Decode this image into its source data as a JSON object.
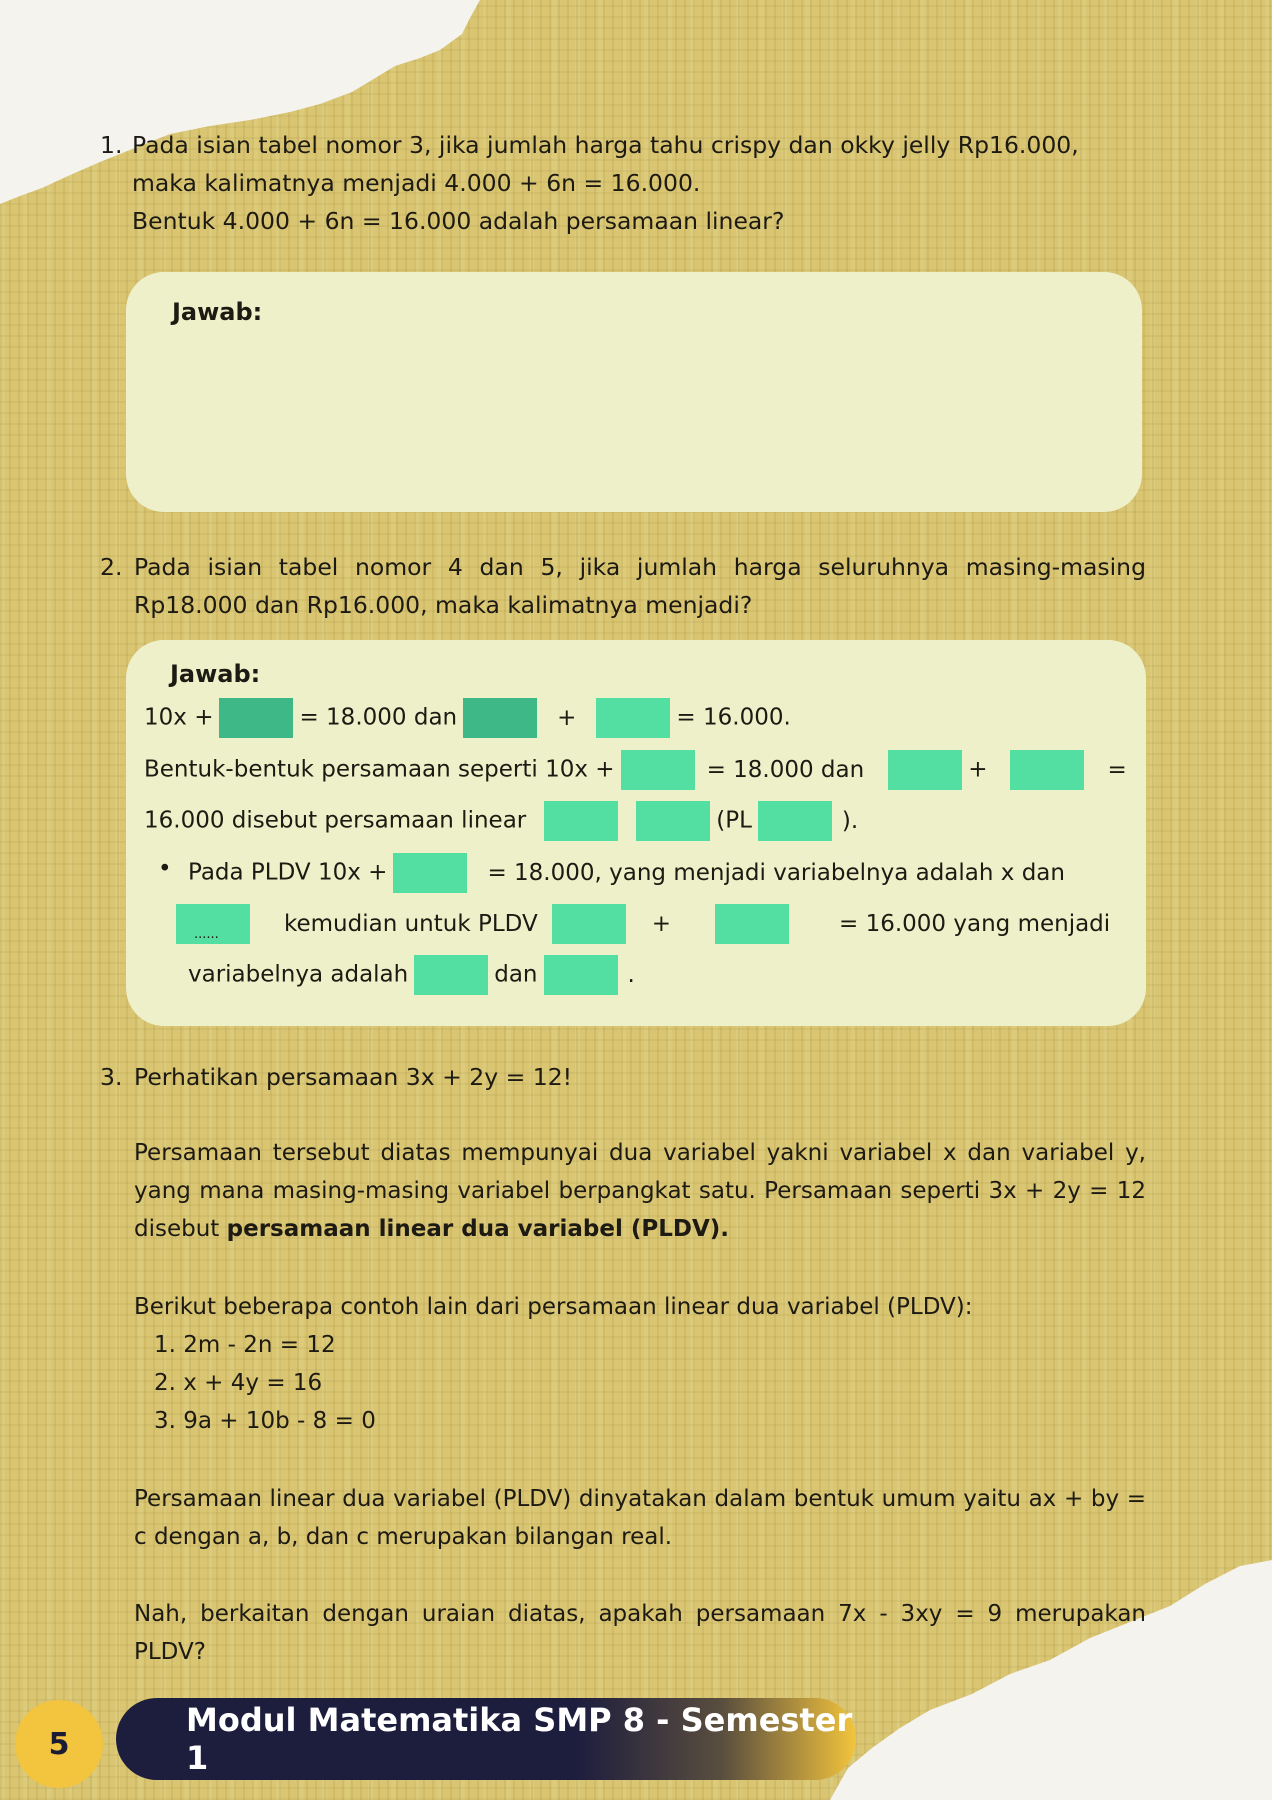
{
  "q1": {
    "number": "1.",
    "line1": "Pada isian tabel nomor 3, jika jumlah harga tahu crispy dan okky jelly Rp16.000,",
    "line2": "maka kalimatnya menjadi 4.000 + 6n = 16.000.",
    "line3": "Bentuk 4.000 + 6n = 16.000 adalah persamaan linear?",
    "answer_label": "Jawab:"
  },
  "q2": {
    "number": "2.",
    "text": "Pada isian tabel nomor 4 dan 5, jika jumlah harga seluruhnya masing-masing Rp18.000 dan Rp16.000, maka kalimatnya menjadi?",
    "answer_label": "Jawab:",
    "row1": {
      "a": "10x +",
      "b": "= 18.000 dan",
      "c": "+",
      "d": "= 16.000."
    },
    "row2": {
      "a": "Bentuk-bentuk persamaan seperti 10x +",
      "b": "= 18.000 dan",
      "c": "+",
      "d": "="
    },
    "row3": {
      "a": "16.000 disebut persamaan linear",
      "b": "(PL",
      "c": ")."
    },
    "bullet_row1": {
      "a": "Pada PLDV 10x +",
      "b": "= 18.000, yang menjadi variabelnya adalah x dan"
    },
    "bullet_row2": {
      "dots": "......",
      "a": "kemudian untuk PLDV",
      "b": "+",
      "c": "= 16.000 yang menjadi"
    },
    "bullet_row3": {
      "a": "variabelnya adalah",
      "b": "dan",
      "c": "."
    }
  },
  "q3": {
    "number": "3.",
    "title": "Perhatikan persamaan 3x + 2y = 12!",
    "para1": "Persamaan tersebut diatas mempunyai dua variabel yakni variabel x dan variabel y, yang mana masing-masing variabel berpangkat satu. Persamaan seperti 3x + 2y = 12 disebut",
    "para1_bold": "persamaan linear dua variabel (PLDV).",
    "para2": "Berikut beberapa contoh lain  dari persamaan linear dua variabel (PLDV):",
    "examples": [
      "1. 2m - 2n = 12",
      "2. x + 4y = 16",
      "3. 9a + 10b - 8 = 0"
    ],
    "para3": "Persamaan linear dua variabel (PLDV) dinyatakan dalam bentuk umum yaitu ax + by = c dengan a, b, dan c merupakan bilangan real.",
    "para4": "Nah, berkaitan dengan uraian diatas, apakah persamaan 7x - 3xy = 9 merupakan PLDV?"
  },
  "footer": {
    "page_number": "5",
    "title": "Modul Matematika SMP 8 - Semester 1"
  },
  "colors": {
    "background": "#d9c572",
    "answer_box": "#eef0c9",
    "blank": "#52dfa1",
    "footer_dark": "#1d1d3e",
    "footer_accent": "#f3c43d"
  }
}
